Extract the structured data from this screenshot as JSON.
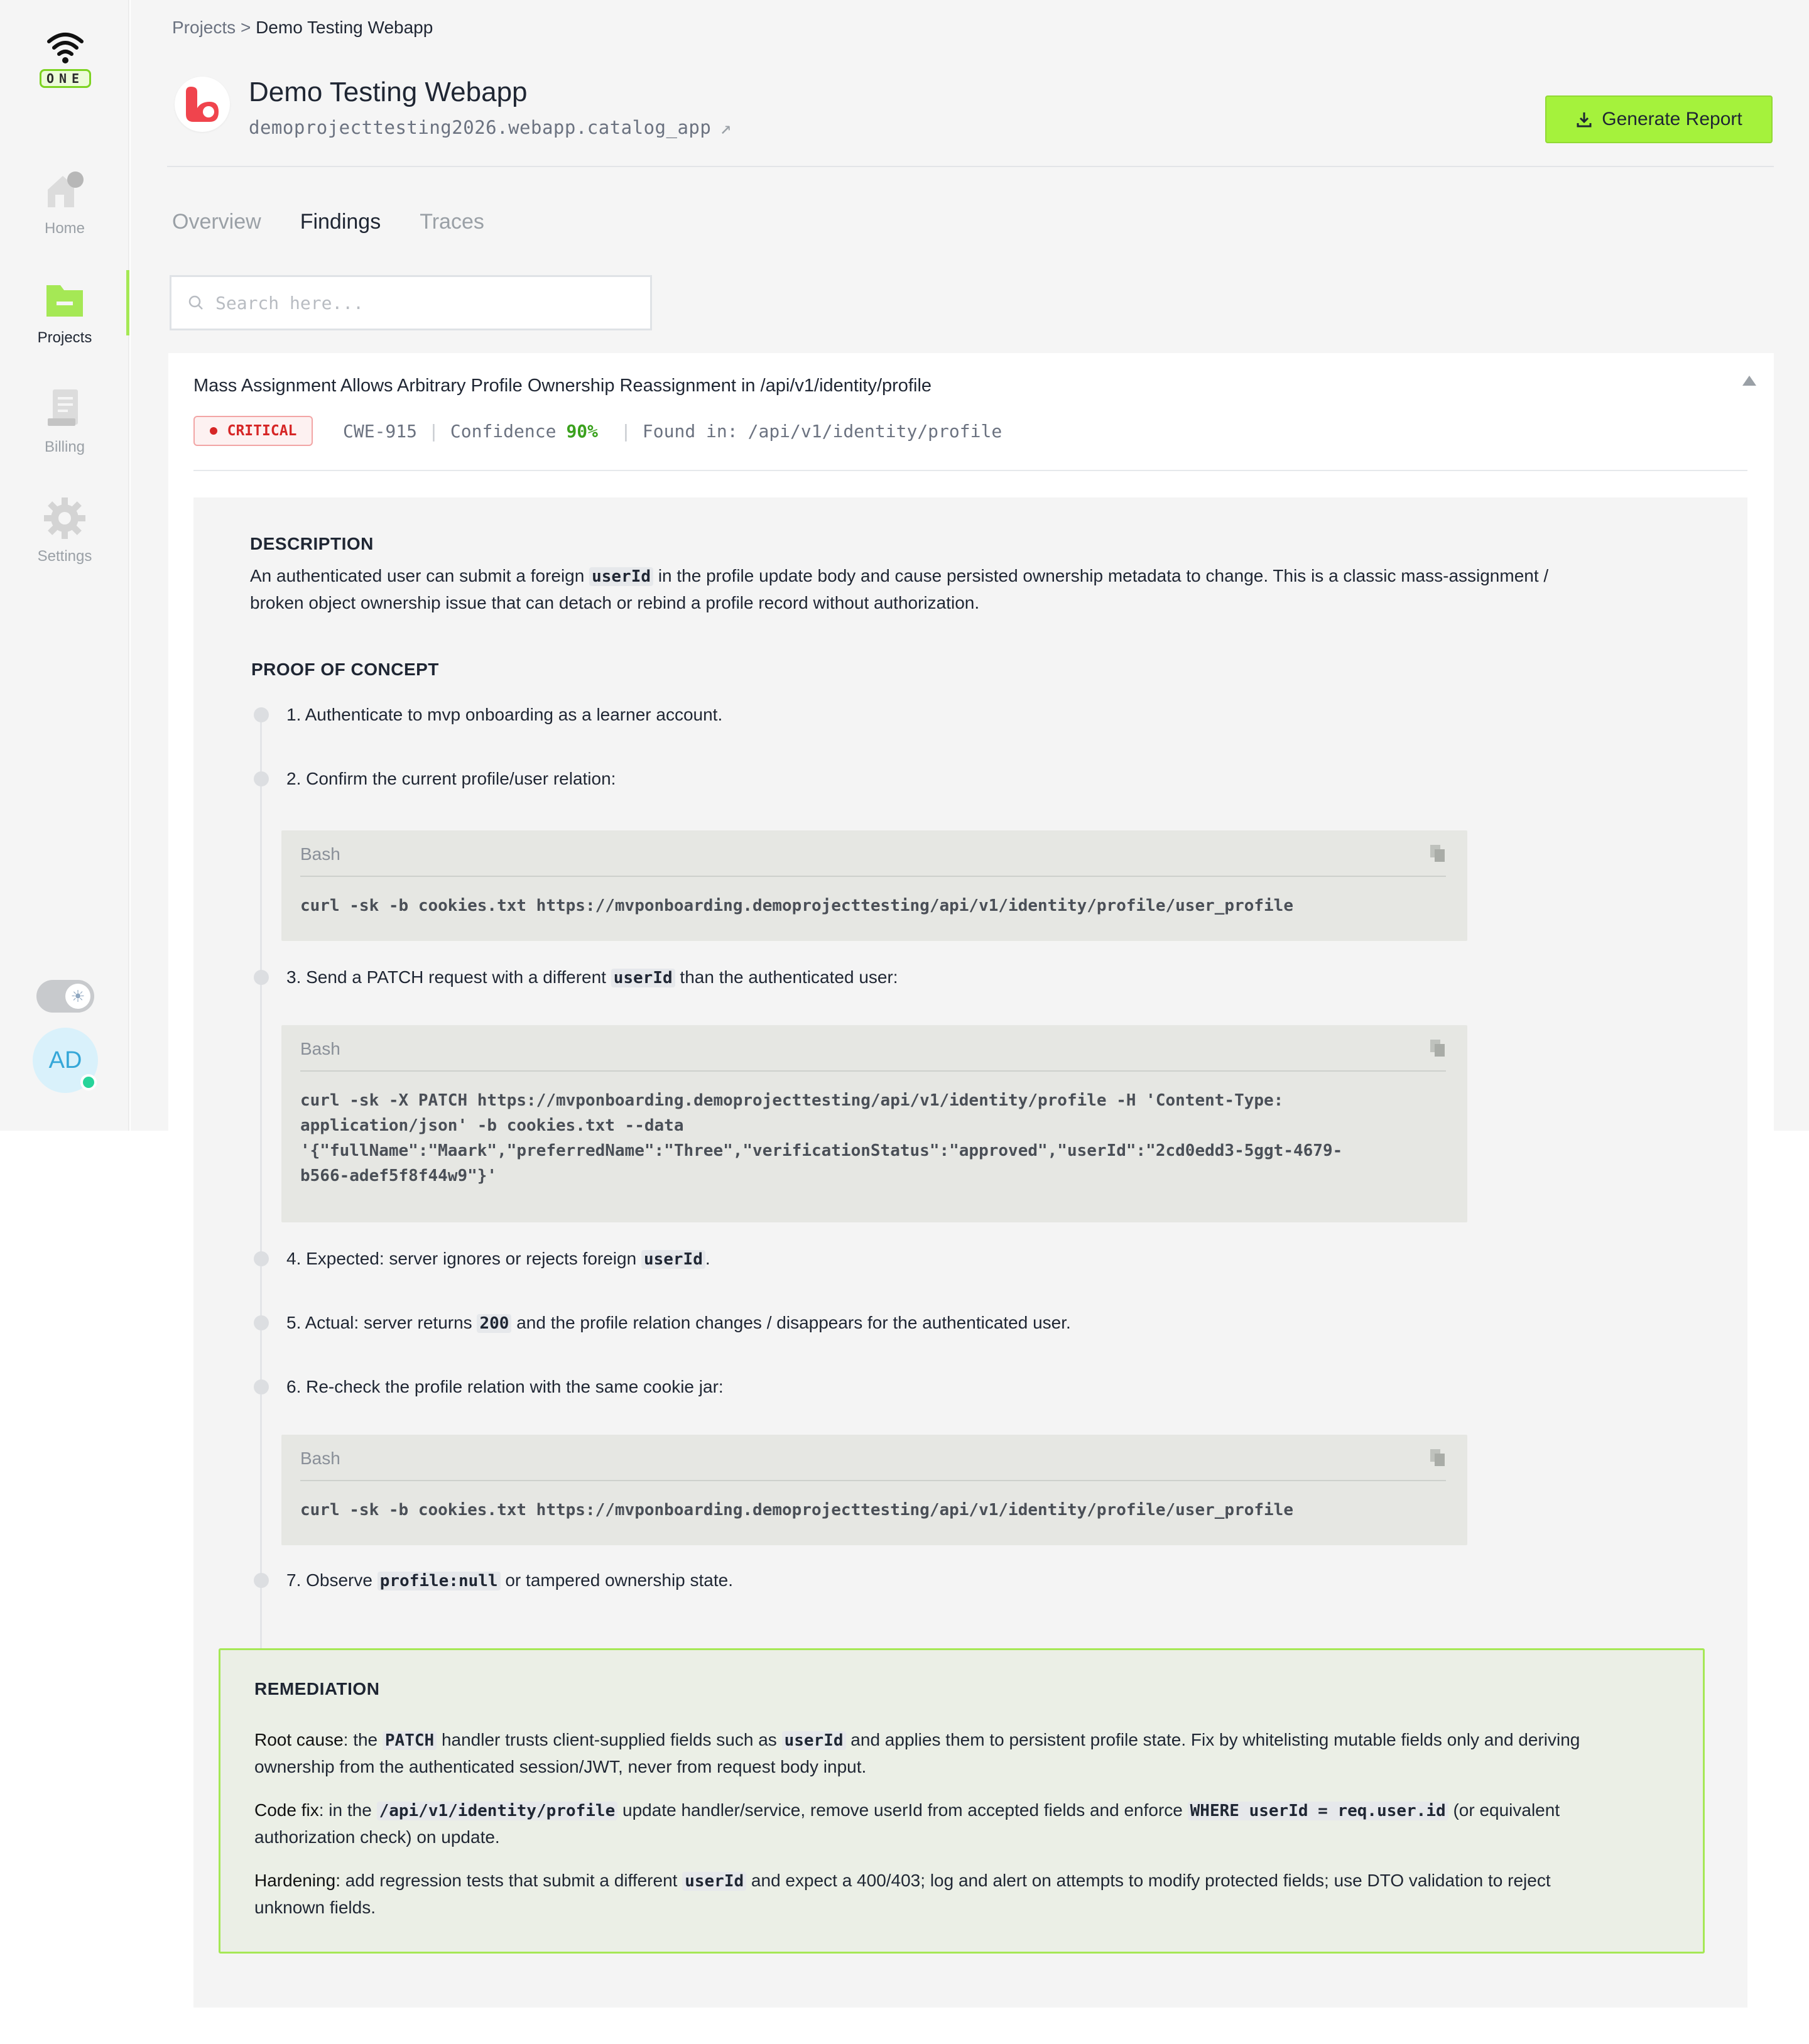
{
  "sidebar": {
    "logo_text": "ONE",
    "items": [
      {
        "label": "Home",
        "icon": "home-icon"
      },
      {
        "label": "Projects",
        "icon": "folder-icon"
      },
      {
        "label": "Billing",
        "icon": "billing-icon"
      },
      {
        "label": "Settings",
        "icon": "gear-icon"
      }
    ],
    "active_item": "Projects",
    "accent_color": "#a5e855",
    "avatar_initials": "AD",
    "status_color": "#27d49a"
  },
  "breadcrumb": {
    "root": "Projects",
    "separator": ">",
    "current": "Demo Testing Webapp"
  },
  "project": {
    "title": "Demo Testing Webapp",
    "subtitle": "demoprojecttesting2026.webapp.catalog_app",
    "external_link_icon": "external-link-icon"
  },
  "actions": {
    "generate_report_label": "Generate Report",
    "button_color": "#a5f23c"
  },
  "tabs": [
    {
      "label": "Overview",
      "active": false
    },
    {
      "label": "Findings",
      "active": true
    },
    {
      "label": "Traces",
      "active": false
    }
  ],
  "search": {
    "placeholder": "Search here...",
    "value": ""
  },
  "finding": {
    "title": "Mass Assignment Allows Arbitrary Profile Ownership Reassignment in /api/v1/identity/profile",
    "severity": "CRITICAL",
    "severity_color": "#d62626",
    "cwe": "CWE-915",
    "confidence_label": "Confidence",
    "confidence_value": "90%",
    "found_in_label": "Found in:",
    "found_in_value": "/api/v1/identity/profile",
    "description_heading": "DESCRIPTION",
    "description": {
      "line1_pre": "An authenticated user can submit a foreign",
      "line1_code": "userId",
      "line1_post": "in the profile update body and cause persisted ownership metadata to change. This is a classic mass-assignment /",
      "line2": "broken object ownership issue that can detach or rebind a profile record without authorization."
    },
    "poc_heading": "PROOF OF CONCEPT",
    "steps": [
      {
        "text": "1. Authenticate to mvp onboarding as a learner account."
      },
      {
        "text": "2. Confirm the current profile/user relation:"
      },
      {
        "pre": "3. Send a PATCH request with a different",
        "code": "userId",
        "post": "than the authenticated user:"
      },
      {
        "pre": "4. Expected: server ignores or rejects foreign",
        "code": "userId",
        "post": "."
      },
      {
        "pre": "5. Actual: server returns",
        "code": "200",
        "post": "and the profile relation changes / disappears for the authenticated user."
      },
      {
        "text": "6. Re-check the profile relation with the same cookie jar:"
      },
      {
        "pre": "7. Observe",
        "code": "profile:null",
        "post": "or tampered ownership state."
      }
    ],
    "code_blocks": [
      {
        "lang": "Bash",
        "code": "curl -sk -b cookies.txt https://mvponboarding.demoprojecttesting/api/v1/identity/profile/user_profile"
      },
      {
        "lang": "Bash",
        "code": "curl -sk -X PATCH https://mvponboarding.demoprojecttesting/api/v1/identity/profile -H 'Content-Type:\napplication/json' -b cookies.txt --data\n'{\"fullName\":\"Maark\",\"preferredName\":\"Three\",\"verificationStatus\":\"approved\",\"userId\":\"2cd0edd3-5ggt-4679-\nb566-adef5f8f44w9\"}'"
      },
      {
        "lang": "Bash",
        "code": "curl -sk -b cookies.txt https://mvponboarding.demoprojecttesting/api/v1/identity/profile/user_profile"
      }
    ],
    "remediation_heading": "REMEDIATION",
    "remediation": {
      "root_cause_label": "Root cause",
      "root_cause_a": ": the",
      "root_cause_code1": "PATCH",
      "root_cause_b": "handler trusts client-supplied fields such as",
      "root_cause_code2": "userId",
      "root_cause_c": "and applies them to persistent profile state. Fix by whitelisting mutable fields only and deriving",
      "root_cause_d": "ownership from the authenticated session/JWT, never from request body input.",
      "code_fix_label": "Code fix",
      "code_fix_a": ": in the",
      "code_fix_code1": "/api/v1/identity/profile",
      "code_fix_b": "update handler/service, remove userId from accepted fields and enforce",
      "code_fix_code2": "WHERE userId = req.user.id",
      "code_fix_c": "(or equivalent",
      "code_fix_d": "authorization check) on update.",
      "hardening_label": "Hardening:",
      "hardening_a": "add regression tests that submit a different",
      "hardening_code": "userId",
      "hardening_b": "and expect a 400/403; log and alert on attempts to modify protected fields; use DTO validation to reject",
      "hardening_c": "unknown fields."
    }
  }
}
